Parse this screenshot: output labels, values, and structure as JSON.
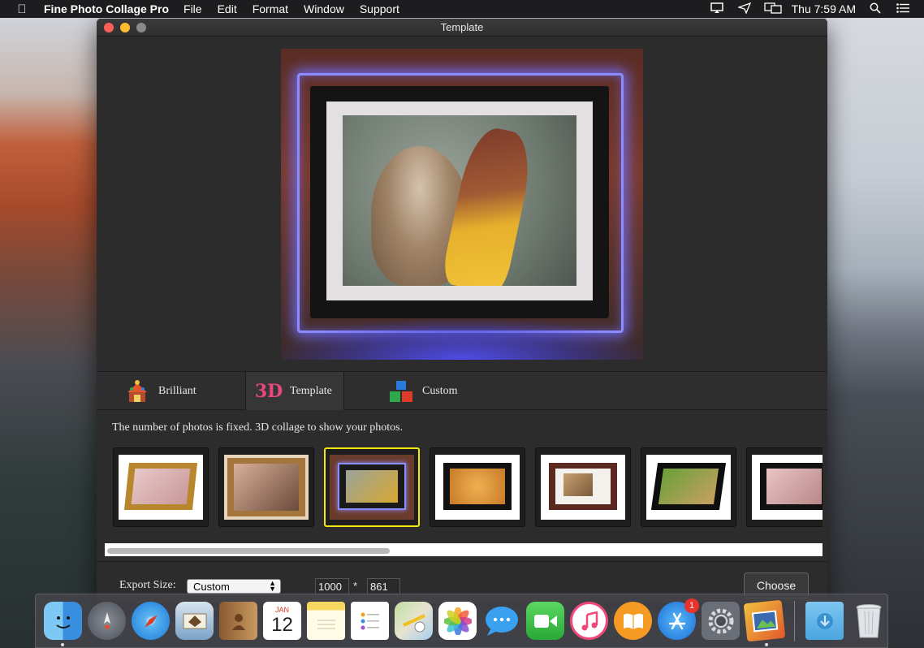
{
  "menubar": {
    "app_name": "Fine Photo Collage Pro",
    "menus": [
      "File",
      "Edit",
      "Format",
      "Window",
      "Support"
    ],
    "clock": "Thu 7:59 AM"
  },
  "window": {
    "title": "Template"
  },
  "tabs": [
    {
      "label": "Brilliant",
      "selected": false
    },
    {
      "label": "Template",
      "icon_text": "3D",
      "selected": true
    },
    {
      "label": "Custom",
      "selected": false
    }
  ],
  "description": "The number of photos is fixed. 3D collage to show your photos.",
  "thumbnails": [
    {
      "name": "kitten-gold-frame",
      "selected": false
    },
    {
      "name": "girl-wood-frame",
      "selected": false
    },
    {
      "name": "chipmunk-glow-frame",
      "selected": true
    },
    {
      "name": "puppy-black-frame",
      "selected": false
    },
    {
      "name": "kittens-brown-frame",
      "selected": false
    },
    {
      "name": "rabbits-black-frame",
      "selected": false
    },
    {
      "name": "kitten-digital-frame",
      "selected": false
    }
  ],
  "export": {
    "label": "Export Size:",
    "size_option": "Custom",
    "width": "1000",
    "times": "*",
    "height": "861",
    "choose_label": "Choose"
  },
  "dock": {
    "calendar_month": "JAN",
    "calendar_day": "12",
    "app_store_badge": "1"
  },
  "colors": {
    "selection": "#f5e60c",
    "glow": "#8c8cff"
  }
}
